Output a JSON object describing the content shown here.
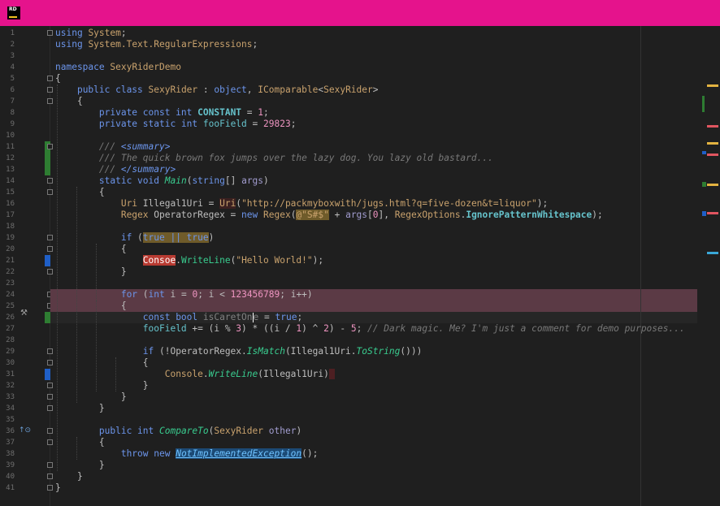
{
  "app": {
    "logo_text": "RD"
  },
  "colors": {
    "titlebar": "#e5138c",
    "error": "#e0443e"
  },
  "editor": {
    "error_indicator": "!",
    "lines": [
      {
        "n": "1",
        "segs": [
          [
            "kw",
            "using"
          ],
          [
            "p",
            " "
          ],
          [
            "ns",
            "System"
          ],
          [
            "p",
            ";"
          ]
        ]
      },
      {
        "n": "2",
        "segs": [
          [
            "kw",
            "using"
          ],
          [
            "p",
            " "
          ],
          [
            "ns",
            "System.Text.RegularExpressions"
          ],
          [
            "p",
            ";"
          ]
        ]
      },
      {
        "n": "3",
        "segs": []
      },
      {
        "n": "4",
        "segs": [
          [
            "kw",
            "namespace"
          ],
          [
            "p",
            " "
          ],
          [
            "ns",
            "SexyRiderDemo"
          ]
        ]
      },
      {
        "n": "5",
        "segs": [
          [
            "p",
            "{"
          ]
        ]
      },
      {
        "n": "6",
        "segs": [
          [
            "p",
            "    "
          ],
          [
            "kw",
            "public class"
          ],
          [
            "p",
            " "
          ],
          [
            "cls",
            "SexyRider"
          ],
          [
            "p",
            " : "
          ],
          [
            "kw",
            "object"
          ],
          [
            "p",
            ", "
          ],
          [
            "cls",
            "IComparable"
          ],
          [
            "p",
            "<"
          ],
          [
            "cls",
            "SexyRider"
          ],
          [
            "p",
            ">"
          ]
        ]
      },
      {
        "n": "7",
        "segs": [
          [
            "p",
            "    {"
          ]
        ]
      },
      {
        "n": "8",
        "segs": [
          [
            "p",
            "        "
          ],
          [
            "kw",
            "private const int"
          ],
          [
            "p",
            " "
          ],
          [
            "static",
            "CONSTANT"
          ],
          [
            "p",
            " = "
          ],
          [
            "num",
            "1"
          ],
          [
            "p",
            ";"
          ]
        ]
      },
      {
        "n": "9",
        "segs": [
          [
            "p",
            "        "
          ],
          [
            "kw",
            "private static int"
          ],
          [
            "p",
            " "
          ],
          [
            "field",
            "fooField"
          ],
          [
            "p",
            " = "
          ],
          [
            "num",
            "29823"
          ],
          [
            "p",
            ";"
          ]
        ]
      },
      {
        "n": "10",
        "segs": []
      },
      {
        "n": "11",
        "segs": [
          [
            "p",
            "        "
          ],
          [
            "doc",
            "/// "
          ],
          [
            "doctag",
            "<summary>"
          ]
        ]
      },
      {
        "n": "12",
        "segs": [
          [
            "p",
            "        "
          ],
          [
            "doc",
            "/// The quick brown fox jumps over the lazy dog. You lazy old bastard..."
          ]
        ]
      },
      {
        "n": "13",
        "segs": [
          [
            "p",
            "        "
          ],
          [
            "doc",
            "/// "
          ],
          [
            "doctag",
            "</summary>"
          ]
        ]
      },
      {
        "n": "14",
        "segs": [
          [
            "p",
            "        "
          ],
          [
            "kw",
            "static void"
          ],
          [
            "p",
            " "
          ],
          [
            "methit",
            "Main"
          ],
          [
            "p",
            "("
          ],
          [
            "kw",
            "string"
          ],
          [
            "p",
            "[] "
          ],
          [
            "param",
            "args"
          ],
          [
            "p",
            ")"
          ]
        ]
      },
      {
        "n": "15",
        "segs": [
          [
            "p",
            "        {"
          ]
        ]
      },
      {
        "n": "16",
        "segs": [
          [
            "p",
            "            "
          ],
          [
            "cls",
            "Uri"
          ],
          [
            "p",
            " Illegal1Uri = "
          ],
          [
            "clsdim",
            "Uri"
          ],
          [
            "p",
            "("
          ],
          [
            "str",
            "\"http://packmyboxwith/jugs.html?q=five-dozen&t=liquor\""
          ],
          [
            "p",
            ");"
          ]
        ]
      },
      {
        "n": "17",
        "segs": [
          [
            "p",
            "            "
          ],
          [
            "cls",
            "Regex"
          ],
          [
            "p",
            " OperatorRegex = "
          ],
          [
            "kw",
            "new"
          ],
          [
            "p",
            " "
          ],
          [
            "cls",
            "Regex"
          ],
          [
            "p",
            "("
          ],
          [
            "strhl",
            "@\"S#$\""
          ],
          [
            "p",
            " + "
          ],
          [
            "param",
            "args"
          ],
          [
            "p",
            "["
          ],
          [
            "num",
            "0"
          ],
          [
            "p",
            "], "
          ],
          [
            "cls",
            "RegexOptions"
          ],
          [
            "p",
            "."
          ],
          [
            "enum",
            "IgnorePatternWhitespace"
          ],
          [
            "p",
            ");"
          ]
        ]
      },
      {
        "n": "18",
        "segs": []
      },
      {
        "n": "19",
        "segs": [
          [
            "p",
            "            "
          ],
          [
            "kw",
            "if"
          ],
          [
            "p",
            " ("
          ],
          [
            "kwhl",
            "true || true"
          ],
          [
            "p",
            ")"
          ]
        ]
      },
      {
        "n": "20",
        "segs": [
          [
            "p",
            "            {"
          ]
        ]
      },
      {
        "n": "21",
        "segs": [
          [
            "p",
            "                "
          ],
          [
            "clsred",
            "Consoe"
          ],
          [
            "p",
            "."
          ],
          [
            "meth",
            "WriteLine"
          ],
          [
            "p",
            "("
          ],
          [
            "str",
            "\"Hello World!\""
          ],
          [
            "p",
            ");"
          ]
        ]
      },
      {
        "n": "22",
        "segs": [
          [
            "p",
            "            }"
          ]
        ]
      },
      {
        "n": "23",
        "segs": []
      },
      {
        "n": "24",
        "segs": [
          [
            "p",
            "            "
          ],
          [
            "kw",
            "for"
          ],
          [
            "p",
            " ("
          ],
          [
            "kw",
            "int"
          ],
          [
            "p",
            " i = "
          ],
          [
            "num",
            "0"
          ],
          [
            "p",
            "; i < "
          ],
          [
            "num",
            "123456789"
          ],
          [
            "p",
            "; i++)"
          ]
        ]
      },
      {
        "n": "25",
        "segs": [
          [
            "p",
            "            {"
          ]
        ]
      },
      {
        "n": "26",
        "segs": [
          [
            "p",
            "                "
          ],
          [
            "kw",
            "const bool"
          ],
          [
            "p",
            " "
          ],
          [
            "dimhl",
            "isCaretOn"
          ],
          [
            "caret",
            ""
          ],
          [
            "dimhl",
            "e"
          ],
          [
            "p",
            " = "
          ],
          [
            "kw",
            "true"
          ],
          [
            "p",
            ";"
          ]
        ]
      },
      {
        "n": "27",
        "segs": [
          [
            "p",
            "                "
          ],
          [
            "field",
            "fooField"
          ],
          [
            "p",
            " += (i % "
          ],
          [
            "num",
            "3"
          ],
          [
            "p",
            ") * ((i / "
          ],
          [
            "num",
            "1"
          ],
          [
            "p",
            ") ^ "
          ],
          [
            "num",
            "2"
          ],
          [
            "p",
            ") - "
          ],
          [
            "num",
            "5"
          ],
          [
            "p",
            "; "
          ],
          [
            "cmt",
            "// Dark magic. Me? I'm just a comment for demo purposes..."
          ]
        ]
      },
      {
        "n": "28",
        "segs": []
      },
      {
        "n": "29",
        "segs": [
          [
            "p",
            "                "
          ],
          [
            "kw",
            "if"
          ],
          [
            "p",
            " (!OperatorRegex."
          ],
          [
            "methit",
            "IsMatch"
          ],
          [
            "p",
            "(Illegal1Uri."
          ],
          [
            "methit",
            "ToString"
          ],
          [
            "p",
            "()))"
          ]
        ]
      },
      {
        "n": "30",
        "segs": [
          [
            "p",
            "                {"
          ]
        ]
      },
      {
        "n": "31",
        "segs": [
          [
            "p",
            "                    "
          ],
          [
            "cls",
            "Console"
          ],
          [
            "p",
            "."
          ],
          [
            "methit",
            "WriteLine"
          ],
          [
            "p",
            "(Illegal1Uri)"
          ],
          [
            "err",
            " "
          ]
        ]
      },
      {
        "n": "32",
        "segs": [
          [
            "p",
            "                }"
          ]
        ]
      },
      {
        "n": "33",
        "segs": [
          [
            "p",
            "            }"
          ]
        ]
      },
      {
        "n": "34",
        "segs": [
          [
            "p",
            "        }"
          ]
        ]
      },
      {
        "n": "35",
        "segs": []
      },
      {
        "n": "36",
        "segs": [
          [
            "p",
            "        "
          ],
          [
            "kw",
            "public int"
          ],
          [
            "p",
            " "
          ],
          [
            "methit",
            "CompareTo"
          ],
          [
            "p",
            "("
          ],
          [
            "cls",
            "SexyRider"
          ],
          [
            "p",
            " "
          ],
          [
            "param",
            "other"
          ],
          [
            "p",
            ")"
          ]
        ]
      },
      {
        "n": "37",
        "segs": [
          [
            "p",
            "        {"
          ]
        ]
      },
      {
        "n": "38",
        "segs": [
          [
            "p",
            "            "
          ],
          [
            "kw",
            "throw new"
          ],
          [
            "p",
            " "
          ],
          [
            "bluehl",
            "NotImplementedException"
          ],
          [
            "p",
            "();"
          ]
        ]
      },
      {
        "n": "39",
        "segs": [
          [
            "p",
            "        }"
          ]
        ]
      },
      {
        "n": "40",
        "segs": [
          [
            "p",
            "    }"
          ]
        ]
      },
      {
        "n": "41",
        "segs": [
          [
            "p",
            "}"
          ]
        ]
      }
    ]
  }
}
